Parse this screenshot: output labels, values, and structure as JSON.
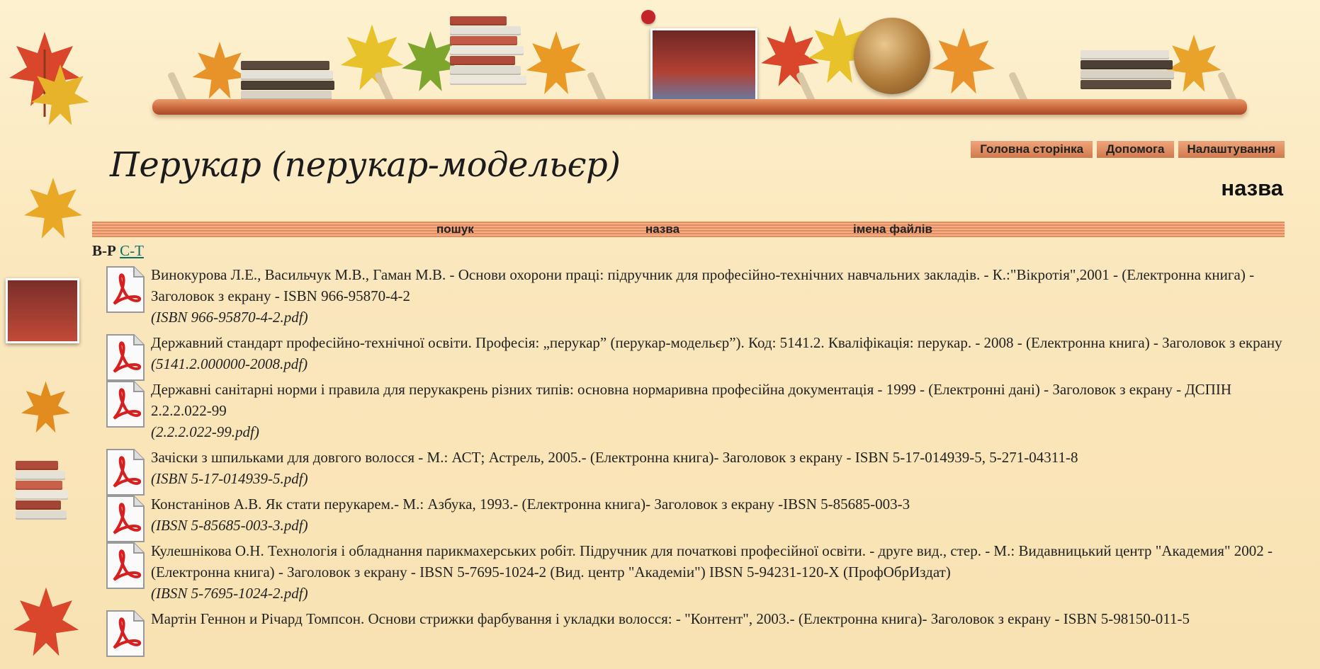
{
  "page": {
    "title": "Перукар (перукар-модельєр)",
    "section_label": "назва"
  },
  "topnav": [
    "Головна сторінка",
    "Допомога",
    "Налаштування"
  ],
  "tabbar": [
    "пошук",
    "назва",
    "імена файлів"
  ],
  "letters": {
    "current": "В-Р",
    "link": "С-Т"
  },
  "items": [
    {
      "text": "Винокурова Л.Е., Васильчук М.В., Гаман М.В. - Основи охорони праці: підручник для професійно-технічних навчальних закладів. - К.:\"Вікротія\",2001 - (Електронна книга) - Заголовок з екрану - ISBN 966-95870-4-2",
      "file": "(ISBN 966-95870-4-2.pdf)"
    },
    {
      "text": "Державний стандарт професійно-технічної освіти. Професія: „перукар” (перукар-модельєр”). Код: 5141.2. Кваліфікація: перукар. - 2008 - (Електронна книга) - Заголовок з екрану",
      "file": "(5141.2.000000-2008.pdf)"
    },
    {
      "text": "Державні санітарні норми і правила для перукакрень різних типів: основна нормаривна професійна документація - 1999 - (Електронні дані) - Заголовок з екрану - ДСПІН 2.2.2.022-99",
      "file": "(2.2.2.022-99.pdf)"
    },
    {
      "text": "Зачіски з шпильками для довгого волосся - М.: АСТ; Астрель, 2005.- (Електронна книга)- Заголовок з екрану - ISBN 5-17-014939-5, 5-271-04311-8",
      "file": "(ISBN 5-17-014939-5.pdf)"
    },
    {
      "text": "Констанінов А.В. Як стати перукарем.- М.: Азбука, 1993.- (Електронна книга)- Заголовок з екрану -IBSN 5-85685-003-3",
      "file": "(IBSN 5-85685-003-3.pdf)"
    },
    {
      "text": "Кулешнікова О.Н. Технологія і обладнання парикмахерських робіт. Підручник для початкові професійної освіти. - друге вид., стер. - М.: Видавницький центр \"Академия\" 2002 - (Електронна книга) - Заголовок з екрану - IBSN 5-7695-1024-2 (Вид. центр \"Академіи\") IBSN 5-94231-120-X (ПрофОбрИздат)",
      "file": "(IBSN 5-7695-1024-2.pdf)"
    },
    {
      "text": "Мартін Геннон и Річард Томпсон. Основи стрижки фарбування і укладки волосся: - \"Контент\", 2003.- (Електронна книга)- Заголовок з екрану - ISBN 5-98150-011-5",
      "file": ""
    }
  ],
  "icons": {
    "document": "pdf-file-icon"
  },
  "colors": {
    "accent": "#e58c5e",
    "link": "#0b6e63",
    "background": "#fbe7bd"
  }
}
